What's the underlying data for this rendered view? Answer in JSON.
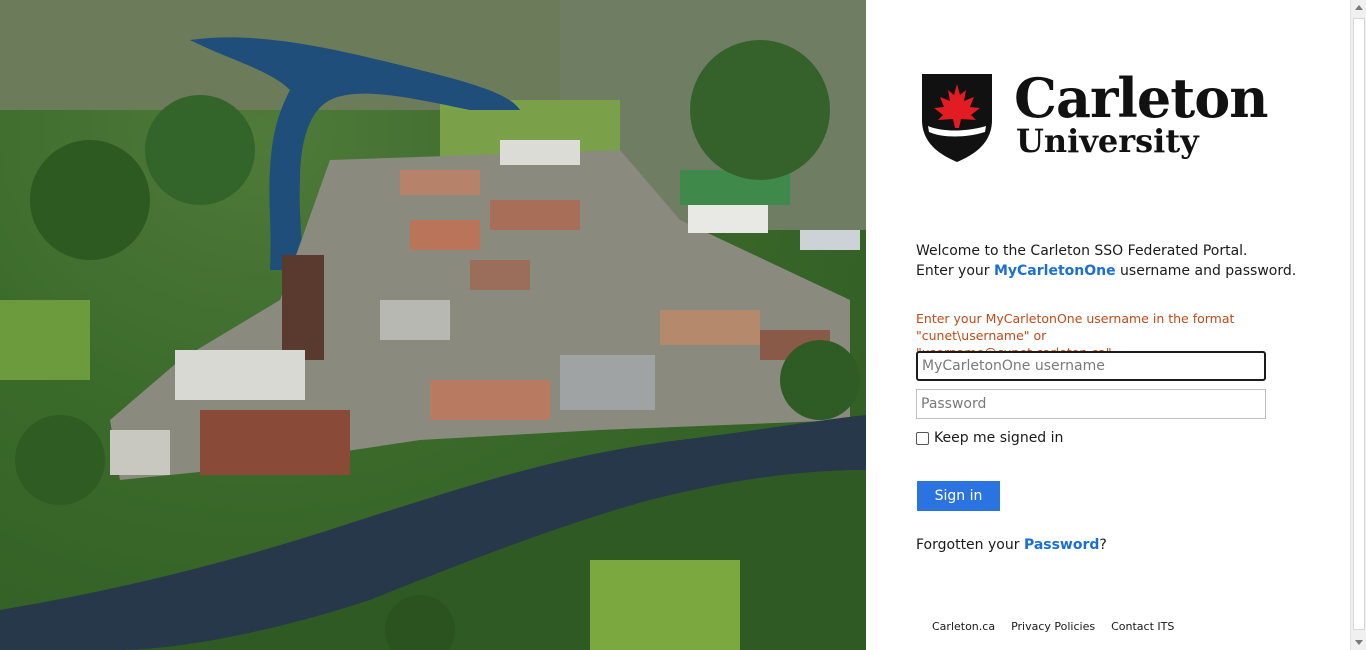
{
  "logo": {
    "name": "Carleton",
    "subtitle": "University"
  },
  "welcome": {
    "line1": "Welcome to the Carleton SSO Federated Portal.",
    "line2_prefix": "Enter your ",
    "line2_link": "MyCarletonOne",
    "line2_suffix": " username and password."
  },
  "error": {
    "line1": "Enter your MyCarletonOne username in the format",
    "line2": "\"cunet\\username\" or \"username@cunet.carleton.ca\"."
  },
  "form": {
    "username_placeholder": "MyCarletonOne username",
    "username_value": "",
    "password_placeholder": "Password",
    "password_value": "",
    "keep_signed_in_label": "Keep me signed in",
    "keep_signed_in_checked": false,
    "signin_label": "Sign in"
  },
  "forgot": {
    "prefix": "Forgotten your ",
    "link": "Password",
    "suffix": "?"
  },
  "footer": {
    "links": [
      "Carleton.ca",
      "Privacy Policies",
      "Contact ITS"
    ]
  },
  "colors": {
    "link": "#1a6fd6",
    "button": "#2b73e0",
    "error": "#c04a18",
    "logo_red": "#e31b23"
  }
}
